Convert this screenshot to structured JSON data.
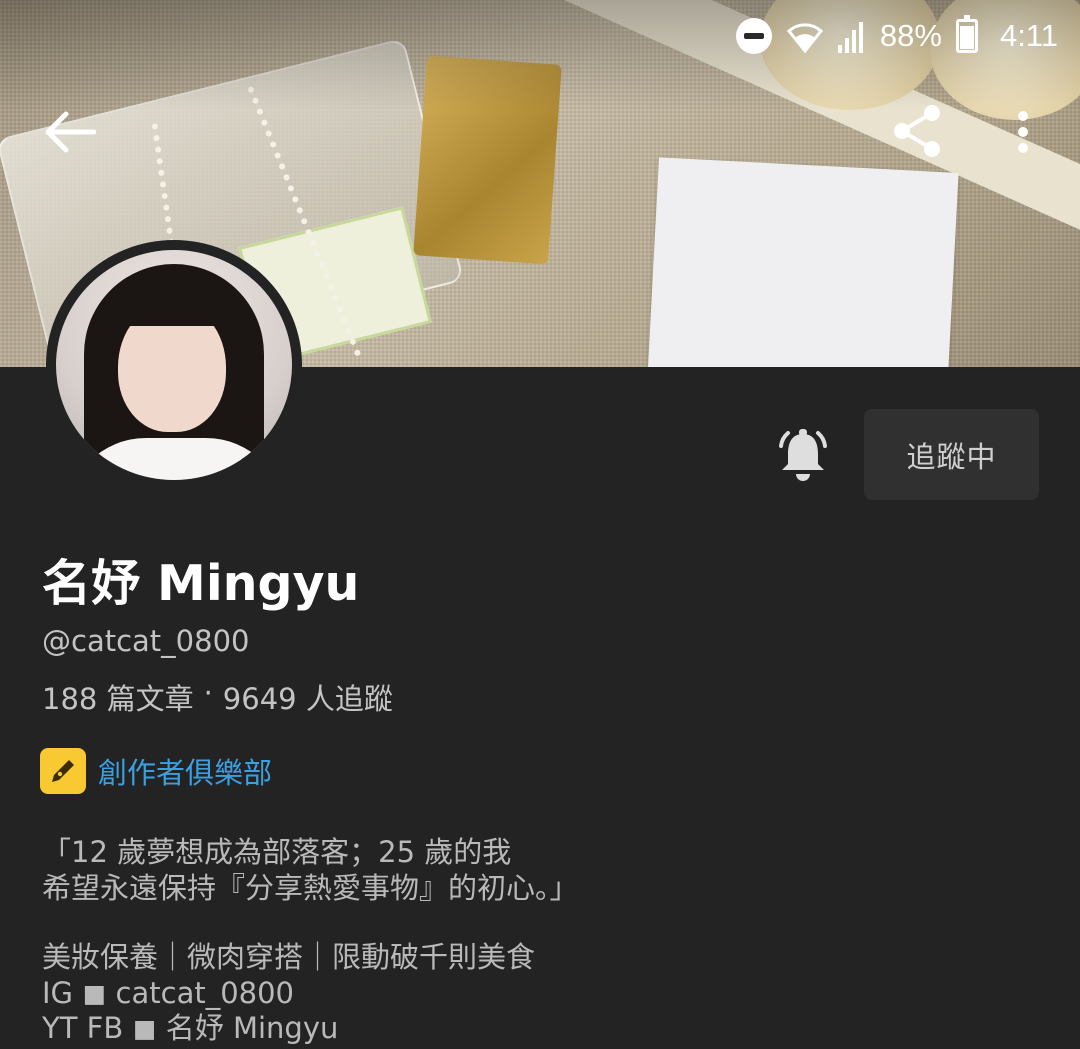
{
  "status_bar": {
    "battery": "88%",
    "time": "4:11",
    "icons": [
      "do-not-disturb-icon",
      "wifi-icon",
      "signal-icon",
      "battery-icon"
    ]
  },
  "app_bar": {
    "icons": [
      "back-arrow-icon",
      "share-icon",
      "more-vert-icon"
    ]
  },
  "profile": {
    "name": "名妤 Mingyu",
    "handle": "@catcat_0800",
    "articles": "188 篇文章",
    "separator": "·",
    "followers": "9649 人追蹤",
    "follow_button": "追蹤中",
    "club_label": "創作者俱樂部"
  },
  "bio": {
    "line1": "「12 歲夢想成為部落客；25 歲的我",
    "line2": "希望永遠保持『分享熱愛事物』的初心。」",
    "line3": "美妝保養｜微肉穿搭｜限動破千則美食",
    "line4": "IG ◼︎ catcat_0800",
    "line5": "YT FB ◼︎ 名妤 Mingyu"
  },
  "colors": {
    "background": "#232324",
    "button_bg": "#303031",
    "link": "#3aa0e0",
    "club_badge": "#f8c930"
  }
}
